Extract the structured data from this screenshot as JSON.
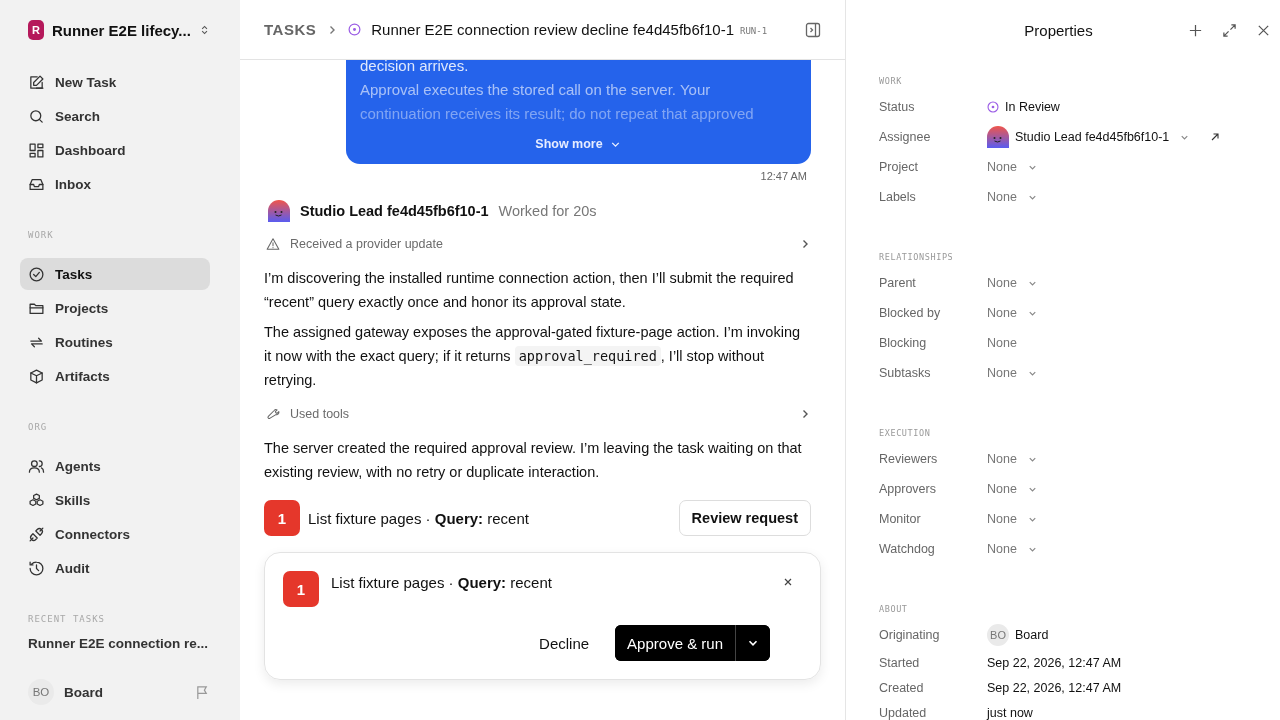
{
  "sidebar": {
    "workspace": {
      "initial": "R",
      "name": "Runner E2E lifecy..."
    },
    "top_items": [
      {
        "label": "New Task"
      },
      {
        "label": "Search"
      },
      {
        "label": "Dashboard"
      },
      {
        "label": "Inbox"
      }
    ],
    "sections": [
      {
        "title": "WORK",
        "items": [
          {
            "label": "Tasks",
            "selected": true
          },
          {
            "label": "Projects",
            "selected": false
          },
          {
            "label": "Routines",
            "selected": false
          },
          {
            "label": "Artifacts",
            "selected": false
          }
        ]
      },
      {
        "title": "ORG",
        "items": [
          {
            "label": "Agents",
            "selected": false
          },
          {
            "label": "Skills",
            "selected": false
          },
          {
            "label": "Connectors",
            "selected": false
          },
          {
            "label": "Audit",
            "selected": false
          }
        ]
      }
    ],
    "recent": {
      "title": "RECENT TASKS",
      "items": [
        "Runner E2E connection re..."
      ]
    },
    "user": {
      "initials": "BO",
      "name": "Board"
    }
  },
  "header": {
    "root": "TASKS",
    "title": "Runner E2E connection review decline fe4d45fb6f10-1",
    "id": "RUN-1"
  },
  "message": {
    "lines": [
      {
        "text": "decision arrives.",
        "faded": false
      },
      {
        "text": "Approval executes the stored call on the server. Your",
        "faded": false
      },
      {
        "text": "continuation receives its result; do not repeat that approved",
        "faded": true
      }
    ],
    "show_more": "Show more",
    "time": "12:47 AM"
  },
  "agent": {
    "name": "Studio Lead fe4d45fb6f10-1",
    "status": "Worked for 20s"
  },
  "activity": [
    {
      "kind": "notice",
      "label": "Received a provider update"
    },
    {
      "kind": "text",
      "segments": [
        {
          "kind": "text",
          "text": "I’m discovering the installed runtime connection action, then I’ll submit the required “recent” query exactly once and honor its approval state."
        }
      ]
    },
    {
      "kind": "text",
      "segments": [
        {
          "kind": "text",
          "text": "The assigned gateway exposes the approval-gated fixture-page action. I’m invoking it now with the exact query; if it returns "
        },
        {
          "kind": "code",
          "text": "approval_required"
        },
        {
          "kind": "text",
          "text": ", I’ll stop without retrying."
        }
      ]
    },
    {
      "kind": "tools",
      "label": "Used tools"
    },
    {
      "kind": "text",
      "segments": [
        {
          "kind": "text",
          "text": "The server created the required approval review. I’m leaving the task waiting on that existing review, with no retry or duplicate interaction."
        }
      ]
    }
  ],
  "request": {
    "badge": "1",
    "text": "List fixture pages · **Query:** recent",
    "button": "Review request"
  },
  "approval": {
    "badge": "1",
    "text": "List fixture pages · **Query:** recent",
    "decline": "Decline",
    "approve": "Approve & run"
  },
  "properties": {
    "title": "Properties",
    "sections": [
      {
        "title": "WORK",
        "rows": [
          {
            "label": "Status",
            "value": "In Review",
            "kind": "status",
            "dropdown": false
          },
          {
            "label": "Assignee",
            "value": "Studio Lead fe4d45fb6f10-1",
            "kind": "agent",
            "dropdown": true
          },
          {
            "label": "Project",
            "value": "None",
            "kind": "empty",
            "dropdown": true
          },
          {
            "label": "Labels",
            "value": "None",
            "kind": "empty",
            "dropdown": true
          }
        ]
      },
      {
        "title": "RELATIONSHIPS",
        "rows": [
          {
            "label": "Parent",
            "value": "None",
            "kind": "empty",
            "dropdown": true
          },
          {
            "label": "Blocked by",
            "value": "None",
            "kind": "empty",
            "dropdown": true
          },
          {
            "label": "Blocking",
            "value": "None",
            "kind": "empty",
            "dropdown": false
          },
          {
            "label": "Subtasks",
            "value": "None",
            "kind": "empty",
            "dropdown": true
          }
        ]
      },
      {
        "title": "EXECUTION",
        "rows": [
          {
            "label": "Reviewers",
            "value": "None",
            "kind": "empty",
            "dropdown": true
          },
          {
            "label": "Approvers",
            "value": "None",
            "kind": "empty",
            "dropdown": true
          },
          {
            "label": "Monitor",
            "value": "None",
            "kind": "empty",
            "dropdown": true
          },
          {
            "label": "Watchdog",
            "value": "None",
            "kind": "empty",
            "dropdown": true
          }
        ]
      },
      {
        "title": "ABOUT",
        "rows": [
          {
            "label": "Originating",
            "value": "Board",
            "initials": "BO",
            "kind": "user",
            "dropdown": false
          },
          {
            "label": "Started",
            "value": "Sep 22, 2026, 12:47 AM",
            "kind": "plain",
            "dropdown": false
          },
          {
            "label": "Created",
            "value": "Sep 22, 2026, 12:47 AM",
            "kind": "plain",
            "dropdown": false
          },
          {
            "label": "Updated",
            "value": "just now",
            "kind": "plain",
            "dropdown": false
          }
        ]
      }
    ]
  }
}
